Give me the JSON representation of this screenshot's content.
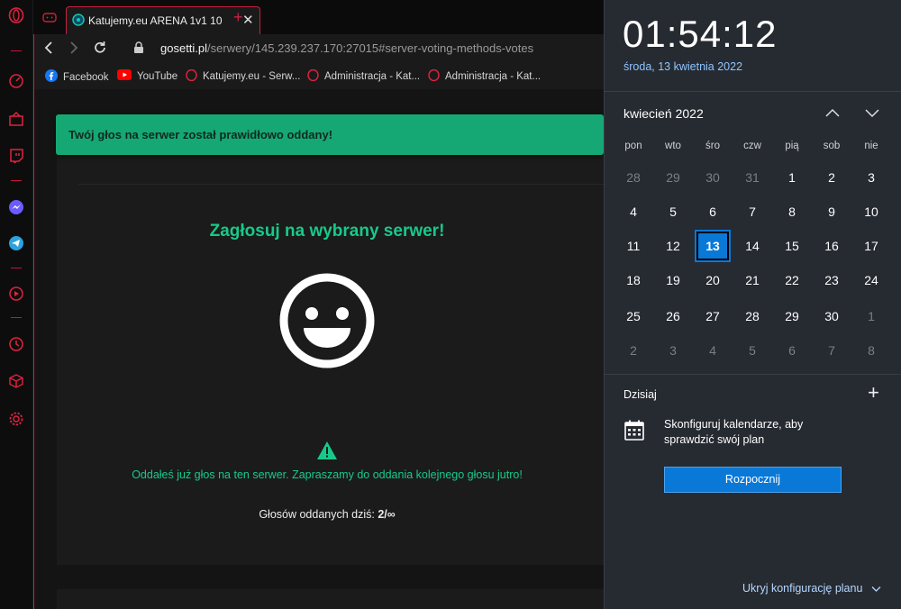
{
  "tabs": {
    "active": {
      "title": "Katujemy.eu ARENA 1v1 10"
    },
    "add_symbol": "+"
  },
  "address": {
    "domain": "gosetti.pl",
    "path": "/serwery/145.239.237.170:27015#server-voting-methods-votes"
  },
  "bookmarks": [
    {
      "label": "Facebook",
      "icon": "facebook-icon"
    },
    {
      "label": "YouTube",
      "icon": "youtube-icon"
    },
    {
      "label": "Katujemy.eu - Serw...",
      "icon": "opera-icon"
    },
    {
      "label": "Administracja - Kat...",
      "icon": "opera-icon"
    },
    {
      "label": "Administracja - Kat...",
      "icon": "opera-icon"
    }
  ],
  "page": {
    "toast": "Twój głos na serwer został prawidłowo oddany!",
    "heading": "Zagłosuj na wybrany serwer!",
    "notice": "Oddałeś już głos na ten serwer. Zapraszamy do oddania kolejnego głosu jutro!",
    "votes_label": "Głosów oddanych dziś:",
    "votes_value": "2/∞"
  },
  "calendar": {
    "time": "01:54:12",
    "date": "środa, 13 kwietnia 2022",
    "month_title": "kwiecień 2022",
    "weekdays": [
      "pon",
      "wto",
      "śro",
      "czw",
      "pią",
      "sob",
      "nie"
    ],
    "weeks": [
      [
        {
          "d": "28",
          "dim": true
        },
        {
          "d": "29",
          "dim": true
        },
        {
          "d": "30",
          "dim": true
        },
        {
          "d": "31",
          "dim": true
        },
        {
          "d": "1"
        },
        {
          "d": "2"
        },
        {
          "d": "3"
        }
      ],
      [
        {
          "d": "4"
        },
        {
          "d": "5"
        },
        {
          "d": "6"
        },
        {
          "d": "7"
        },
        {
          "d": "8"
        },
        {
          "d": "9"
        },
        {
          "d": "10"
        }
      ],
      [
        {
          "d": "11"
        },
        {
          "d": "12"
        },
        {
          "d": "13",
          "today": true
        },
        {
          "d": "14"
        },
        {
          "d": "15"
        },
        {
          "d": "16"
        },
        {
          "d": "17"
        }
      ],
      [
        {
          "d": "18"
        },
        {
          "d": "19"
        },
        {
          "d": "20"
        },
        {
          "d": "21"
        },
        {
          "d": "22"
        },
        {
          "d": "23"
        },
        {
          "d": "24"
        }
      ],
      [
        {
          "d": "25"
        },
        {
          "d": "26"
        },
        {
          "d": "27"
        },
        {
          "d": "28"
        },
        {
          "d": "29"
        },
        {
          "d": "30"
        },
        {
          "d": "1",
          "dim": true
        }
      ],
      [
        {
          "d": "2",
          "dim": true
        },
        {
          "d": "3",
          "dim": true
        },
        {
          "d": "4",
          "dim": true
        },
        {
          "d": "5",
          "dim": true
        },
        {
          "d": "6",
          "dim": true
        },
        {
          "d": "7",
          "dim": true
        },
        {
          "d": "8",
          "dim": true
        }
      ]
    ],
    "today_label": "Dzisiaj",
    "add_symbol": "+",
    "agenda_text": "Skonfiguruj kalendarze, aby sprawdzić swój plan",
    "start_button": "Rozpocznij",
    "hide_link": "Ukryj konfigurację planu",
    "accent": "#0a78d7"
  }
}
